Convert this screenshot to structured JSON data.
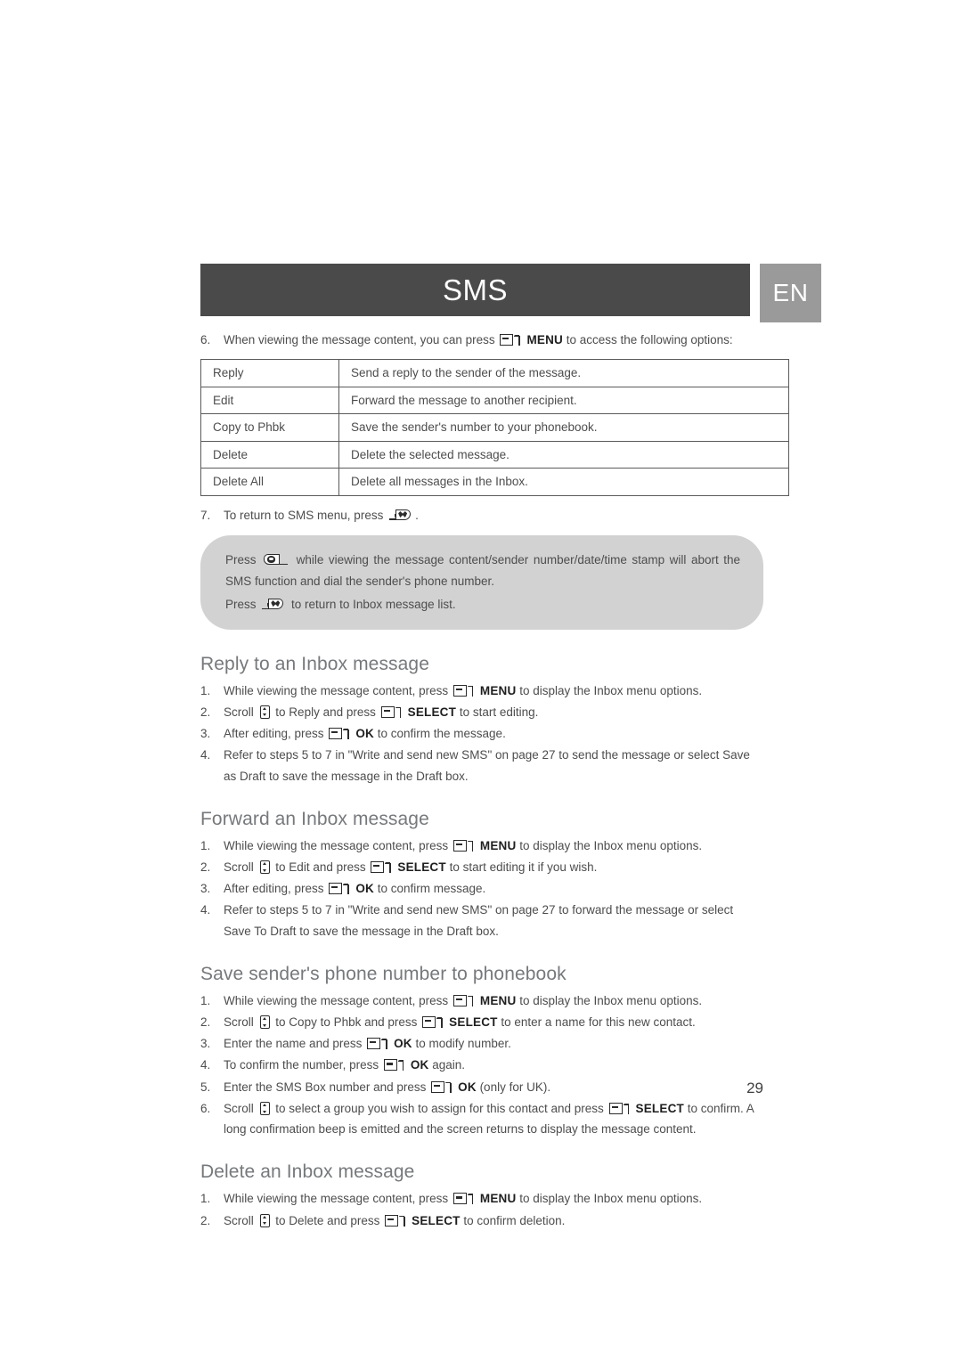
{
  "header": {
    "title": "SMS",
    "language_badge": "EN",
    "title_bar_color": "#4a4a4a",
    "badge_color": "#9a9a9a"
  },
  "intro_step": {
    "number": "6.",
    "text_before": "When viewing the message content, you can press",
    "key_label": "MENU",
    "text_after": "to access the following options:"
  },
  "options_table": {
    "rows": [
      {
        "option": "Reply",
        "description": "Send a reply to the sender of the message."
      },
      {
        "option": "Edit",
        "description": "Forward the message to another recipient."
      },
      {
        "option": "Copy to Phbk",
        "description": "Save the sender's number to your phonebook."
      },
      {
        "option": "Delete",
        "description": "Delete the selected message."
      },
      {
        "option": "Delete All",
        "description": "Delete all messages in the Inbox."
      }
    ]
  },
  "return_step": {
    "number": "7.",
    "text_before": "To return to SMS menu, press",
    "text_after": "."
  },
  "callout": {
    "line1_before": "Press",
    "line1_after": "while viewing the message content/sender number/date/time stamp will abort the SMS function and dial the sender's phone number.",
    "line2_before": "Press",
    "line2_after": "to return to Inbox message list."
  },
  "sections": [
    {
      "heading": "Reply to an Inbox message",
      "steps": [
        {
          "number": "1.",
          "parts": [
            {
              "t": "text",
              "v": "While viewing the message content, press"
            },
            {
              "t": "softkey",
              "v": "MENU"
            },
            {
              "t": "text",
              "v": "to display the Inbox menu options."
            }
          ]
        },
        {
          "number": "2.",
          "parts": [
            {
              "t": "text",
              "v": "Scroll"
            },
            {
              "t": "scroll",
              "v": ""
            },
            {
              "t": "text",
              "v": "to Reply and press"
            },
            {
              "t": "softkey",
              "v": "SELECT"
            },
            {
              "t": "text",
              "v": "to start editing."
            }
          ]
        },
        {
          "number": "3.",
          "parts": [
            {
              "t": "text",
              "v": "After editing, press"
            },
            {
              "t": "softkey",
              "v": "OK"
            },
            {
              "t": "text",
              "v": "to confirm the message."
            }
          ]
        },
        {
          "number": "4.",
          "parts": [
            {
              "t": "text",
              "v": "Refer to steps 5 to 7 in \"Write and send new SMS\" on page 27 to send the message or select Save as Draft to save the message in the Draft box."
            }
          ]
        }
      ]
    },
    {
      "heading": "Forward an Inbox message",
      "steps": [
        {
          "number": "1.",
          "parts": [
            {
              "t": "text",
              "v": "While viewing the message content, press"
            },
            {
              "t": "softkey",
              "v": "MENU"
            },
            {
              "t": "text",
              "v": "to display the Inbox menu options."
            }
          ]
        },
        {
          "number": "2.",
          "parts": [
            {
              "t": "text",
              "v": "Scroll"
            },
            {
              "t": "scroll",
              "v": ""
            },
            {
              "t": "text",
              "v": "to Edit and press"
            },
            {
              "t": "softkey",
              "v": "SELECT"
            },
            {
              "t": "text",
              "v": "to start editing it if you wish."
            }
          ]
        },
        {
          "number": "3.",
          "parts": [
            {
              "t": "text",
              "v": "After editing, press"
            },
            {
              "t": "softkey",
              "v": "OK"
            },
            {
              "t": "text",
              "v": "to confirm message."
            }
          ]
        },
        {
          "number": "4.",
          "parts": [
            {
              "t": "text",
              "v": "Refer to steps 5 to 7 in \"Write and send new SMS\" on page 27 to forward the message or select Save To Draft to save the message in the Draft box."
            }
          ]
        }
      ]
    },
    {
      "heading": "Save sender's phone number to phonebook",
      "steps": [
        {
          "number": "1.",
          "parts": [
            {
              "t": "text",
              "v": "While viewing the message content, press"
            },
            {
              "t": "softkey",
              "v": "MENU"
            },
            {
              "t": "text",
              "v": "to display the Inbox menu options."
            }
          ]
        },
        {
          "number": "2.",
          "parts": [
            {
              "t": "text",
              "v": "Scroll"
            },
            {
              "t": "scroll",
              "v": ""
            },
            {
              "t": "text",
              "v": "to Copy to Phbk and press"
            },
            {
              "t": "softkey",
              "v": "SELECT"
            },
            {
              "t": "text",
              "v": "to enter a name for this new contact."
            }
          ]
        },
        {
          "number": "3.",
          "parts": [
            {
              "t": "text",
              "v": "Enter the name and press"
            },
            {
              "t": "softkey",
              "v": "OK"
            },
            {
              "t": "text",
              "v": "to modify number."
            }
          ]
        },
        {
          "number": "4.",
          "parts": [
            {
              "t": "text",
              "v": "To confirm the number, press"
            },
            {
              "t": "softkey",
              "v": "OK"
            },
            {
              "t": "text",
              "v": "again."
            }
          ]
        },
        {
          "number": "5.",
          "parts": [
            {
              "t": "text",
              "v": "Enter the SMS Box number and press"
            },
            {
              "t": "softkey",
              "v": "OK"
            },
            {
              "t": "text",
              "v": "(only for UK)."
            }
          ]
        },
        {
          "number": "6.",
          "parts": [
            {
              "t": "text",
              "v": "Scroll"
            },
            {
              "t": "scroll",
              "v": ""
            },
            {
              "t": "text",
              "v": "to select a group you wish to assign for this contact and press"
            },
            {
              "t": "softkey",
              "v": "SELECT"
            },
            {
              "t": "text",
              "v": "to confirm. A long confirmation beep is emitted and the screen returns to display the message content."
            }
          ]
        }
      ]
    },
    {
      "heading": "Delete an Inbox message",
      "steps": [
        {
          "number": "1.",
          "parts": [
            {
              "t": "text",
              "v": "While viewing the message content, press"
            },
            {
              "t": "softkey",
              "v": "MENU"
            },
            {
              "t": "text",
              "v": "to display the Inbox menu options."
            }
          ]
        },
        {
          "number": "2.",
          "parts": [
            {
              "t": "text",
              "v": "Scroll"
            },
            {
              "t": "scroll",
              "v": ""
            },
            {
              "t": "text",
              "v": "to Delete and press"
            },
            {
              "t": "softkey",
              "v": "SELECT"
            },
            {
              "t": "text",
              "v": "to confirm deletion."
            }
          ]
        }
      ]
    }
  ],
  "page_number": "29",
  "icons": {
    "softkey": "softkey-icon",
    "scroll": "scroll-updown-icon",
    "hangup": "hangup-key-icon",
    "talk": "talk-key-icon"
  }
}
